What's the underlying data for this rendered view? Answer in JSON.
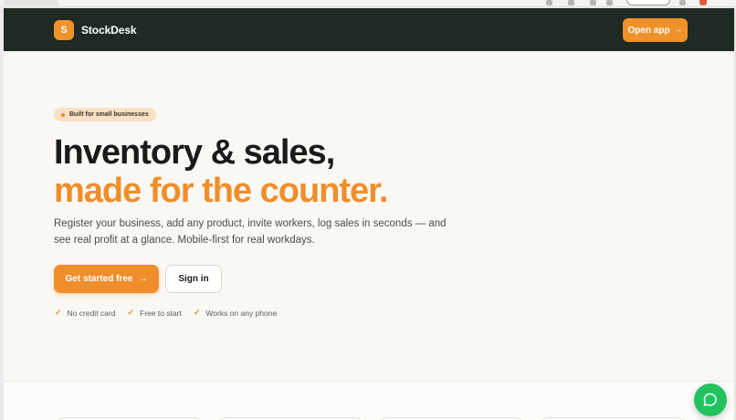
{
  "header": {
    "logo_letter": "S",
    "brand": "StockDesk",
    "open_app_label": "Open app"
  },
  "hero": {
    "badge": "Built for small businesses",
    "title_line1": "Inventory & sales,",
    "title_line2": "made for the counter.",
    "lead": "Register your business, add any product, invite workers, log sales in seconds — and see real profit at a glance. Mobile-first for real workdays.",
    "primary_cta": "Get started free",
    "secondary_cta": "Sign in",
    "perks": [
      "No credit card",
      "Free to start",
      "Works on any phone"
    ]
  },
  "icons": {
    "arrow": "arrow-right-icon",
    "check": "check-icon",
    "chat": "chat-bubble-icon"
  },
  "colors": {
    "accent": "#ef8e2a",
    "header_bg": "#1e2a23",
    "page_bg": "#faf8f4",
    "chat_fab": "#22c35e"
  }
}
